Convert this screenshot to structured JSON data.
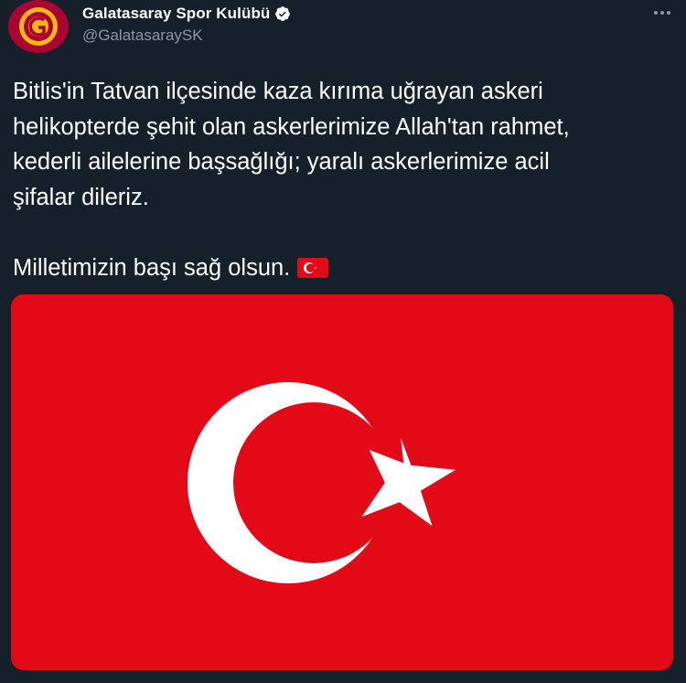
{
  "author": {
    "display_name": "Galatasaray Spor Kulübü",
    "handle": "@GalatasaraySK",
    "verified": true,
    "avatar_icon": "galatasaray-crest-icon"
  },
  "tweet": {
    "line1": "Bitlis'in Tatvan ilçesinde kaza kırıma uğrayan askeri",
    "line2": "helikopterde şehit olan askerlerimize Allah'tan rahmet,",
    "line3": "kederli ailelerine başsağlığı; yaralı askerlerimize acil",
    "line4": "şifalar dileriz.",
    "line5": "Milletimizin başı sağ olsun.",
    "emoji": "turkey-flag-emoji"
  },
  "media": {
    "type": "image",
    "subject": "turkish-flag",
    "colors": {
      "red": "#e30a17",
      "white": "#ffffff"
    }
  },
  "colors": {
    "background": "#15202b",
    "text": "#ffffff",
    "secondary_text": "#8899a6",
    "verified_badge": "#ffffff"
  }
}
